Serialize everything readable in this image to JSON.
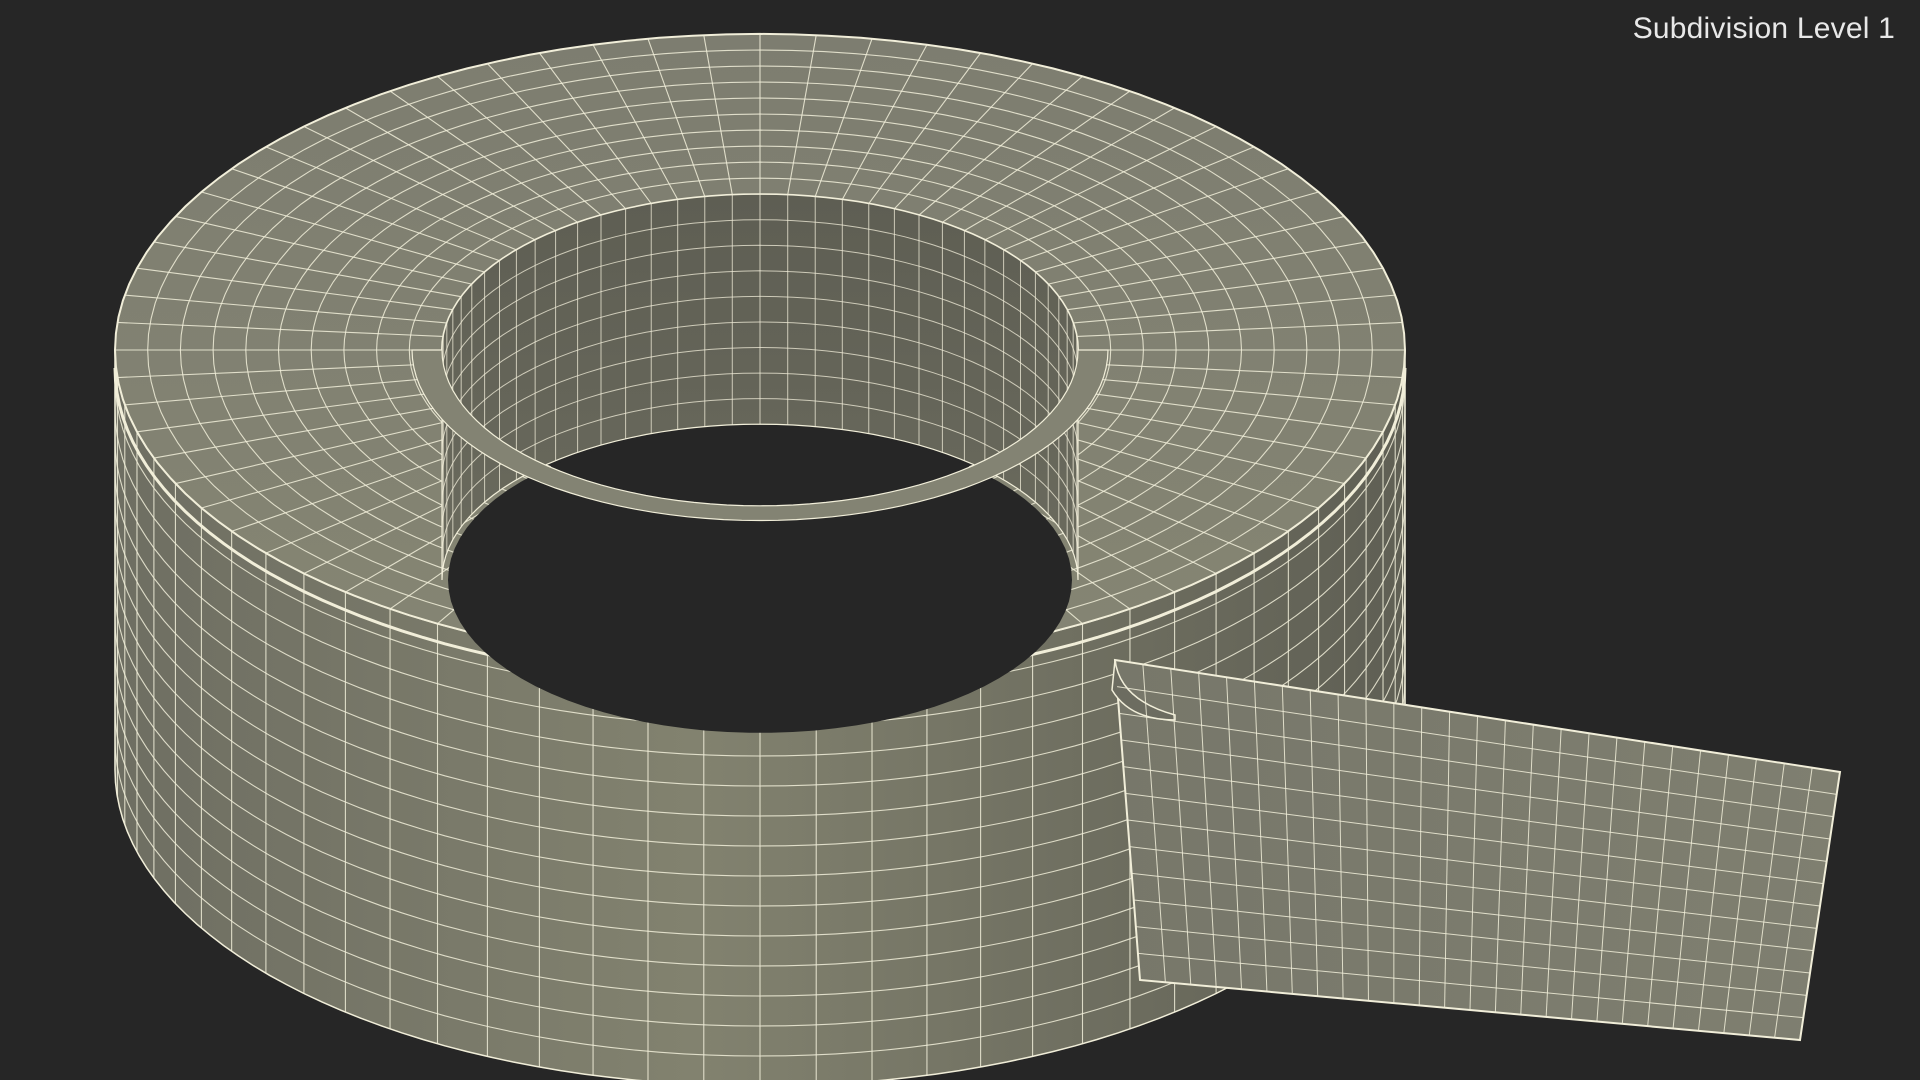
{
  "viewport": {
    "label": "Subdivision Level 1",
    "background_color": "#262626"
  },
  "model": {
    "subject": "tape-roll-wireframe",
    "surface_color": "#7c7c6e",
    "inner_surface_color": "#66665a",
    "hole_color": "#262626",
    "wire_color": "#f1eed9"
  }
}
